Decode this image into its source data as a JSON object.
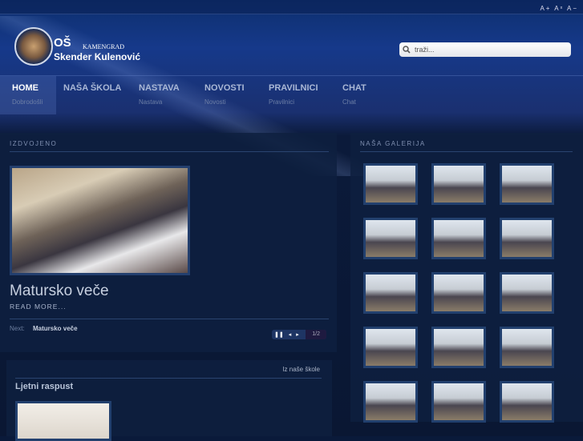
{
  "header": {
    "font_controls": "A+ Aˣ A−",
    "brand_os": "OŠ",
    "brand_town": "KAMENGRAD",
    "brand_name": "Skender Kulenović",
    "search_placeholder": "traži..."
  },
  "nav": [
    {
      "label": "HOME",
      "sub": "Dobrodošli"
    },
    {
      "label": "NAŠA ŠKOLA",
      "sub": ""
    },
    {
      "label": "NASTAVA",
      "sub": "Nastava"
    },
    {
      "label": "NOVOSTI",
      "sub": "Novosti"
    },
    {
      "label": "PRAVILNICI",
      "sub": "Pravilnici"
    },
    {
      "label": "CHAT",
      "sub": "Chat"
    }
  ],
  "featured": {
    "title": "IZDVOJENO",
    "headline": "Matursko veče",
    "read_more": "READ MORE...",
    "next_label": "Next:",
    "next_title": "Matursko veče",
    "page": "1/2"
  },
  "news": {
    "category": "Iz naše škole",
    "title": "Ljetni raspust"
  },
  "gallery": {
    "title": "NAŠA GALERIJA",
    "count": 15
  }
}
